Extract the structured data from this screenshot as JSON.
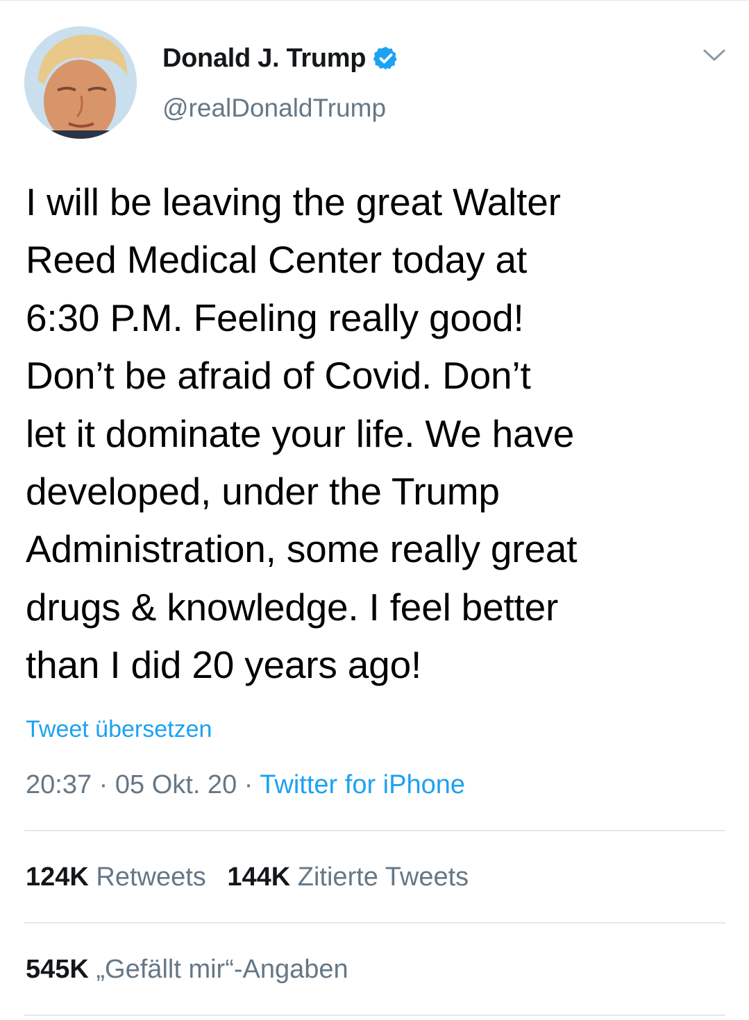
{
  "author": {
    "display_name": "Donald J. Trump",
    "handle": "@realDonaldTrump",
    "verified": true,
    "avatar_icon": "profile-photo"
  },
  "tweet": {
    "text": "I will be leaving the great Walter\nReed Medical Center today at\n6:30 P.M. Feeling really good!\nDon’t be afraid of Covid. Don’t\nlet it dominate your life. We have\ndeveloped, under the Trump\nAdministration, some really great\ndrugs & knowledge. I feel better\nthan I did 20 years ago!",
    "translate_label": "Tweet übersetzen",
    "time": "20:37",
    "separator": "·",
    "date": "05 Okt. 20",
    "source": "Twitter for iPhone"
  },
  "stats": {
    "retweets_count": "124K",
    "retweets_label": "Retweets",
    "quotes_count": "144K",
    "quotes_label": "Zitierte Tweets",
    "likes_count": "545K",
    "likes_label": "„Gefällt mir“-Angaben"
  },
  "colors": {
    "link": "#1da1f2",
    "secondary_text": "#657786",
    "divider": "#e1e8ed",
    "verified_badge": "#1da1f2"
  }
}
